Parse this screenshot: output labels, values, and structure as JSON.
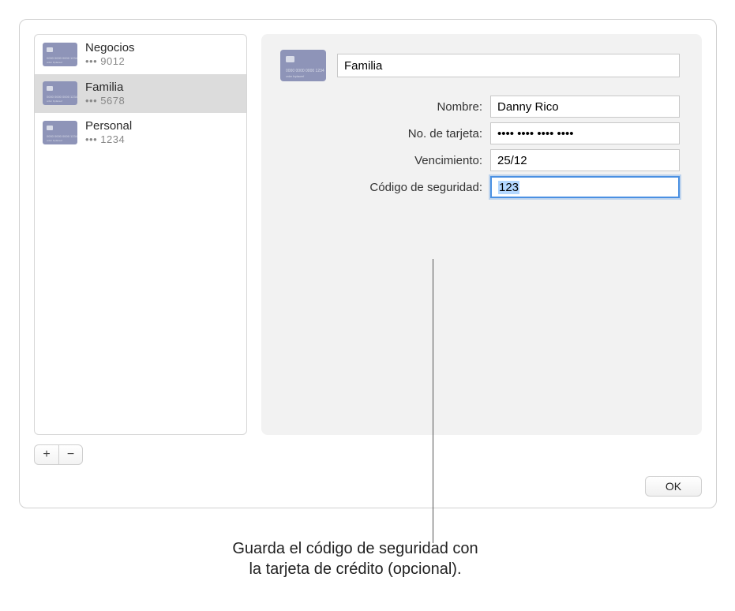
{
  "sidebar": {
    "items": [
      {
        "title": "Negocios",
        "sub": "••• 9012",
        "selected": false
      },
      {
        "title": "Familia",
        "sub": "••• 5678",
        "selected": true
      },
      {
        "title": "Personal",
        "sub": "••• 1234",
        "selected": false
      }
    ]
  },
  "detail": {
    "title_value": "Familia",
    "fields": {
      "name": {
        "label": "Nombre:",
        "value": "Danny Rico"
      },
      "number": {
        "label": "No. de tarjeta:",
        "value": "•••• •••• •••• ••••"
      },
      "expiry": {
        "label": "Vencimiento:",
        "value": "25/12"
      },
      "security": {
        "label": "Código de seguridad:",
        "value": "123"
      }
    }
  },
  "buttons": {
    "add": "+",
    "remove": "−",
    "ok": "OK"
  },
  "callout": {
    "line1": "Guarda el código de seguridad con",
    "line2": "la tarjeta de crédito (opcional)."
  },
  "colors": {
    "card_bg": "#8e94b8",
    "card_chip": "#d9dce8",
    "selection": "#dcdcdc",
    "focus_ring": "#4a90e2"
  }
}
